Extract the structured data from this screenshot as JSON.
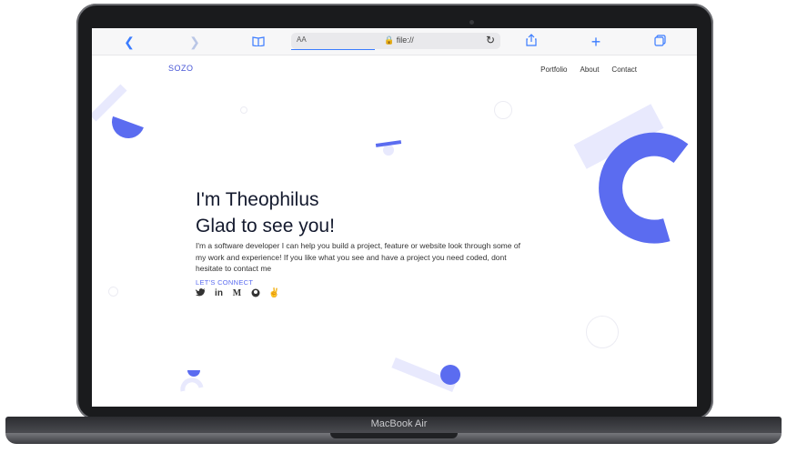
{
  "device": {
    "label": "MacBook Air"
  },
  "browser": {
    "back_icon": "chevron-left-icon",
    "forward_icon": "chevron-right-icon",
    "bookmarks_icon": "book-icon",
    "text_size": "AA",
    "url": "file://",
    "share_icon": "share-icon",
    "new_tab_icon": "plus-icon",
    "tabs_icon": "tabs-icon"
  },
  "site": {
    "logo": "SOZO",
    "nav": [
      "Portfolio",
      "About",
      "Contact"
    ],
    "hero": {
      "line1": "I'm Theophilus",
      "line2": "Glad to see you!",
      "description": "I'm a software developer I can help you build a project, feature or website look through some of my work and experience! If you like what you see and have a project you need coded, dont hesitate to contact me",
      "connect_label": "LET'S CONNECT",
      "social_icons": [
        "twitter-icon",
        "linkedin-icon",
        "medium-icon",
        "github-icon",
        "hashnode-icon"
      ]
    }
  },
  "colors": {
    "accent": "#5b6cf0",
    "accent_light": "#e8e9fd",
    "text_dark": "#141a2e"
  }
}
